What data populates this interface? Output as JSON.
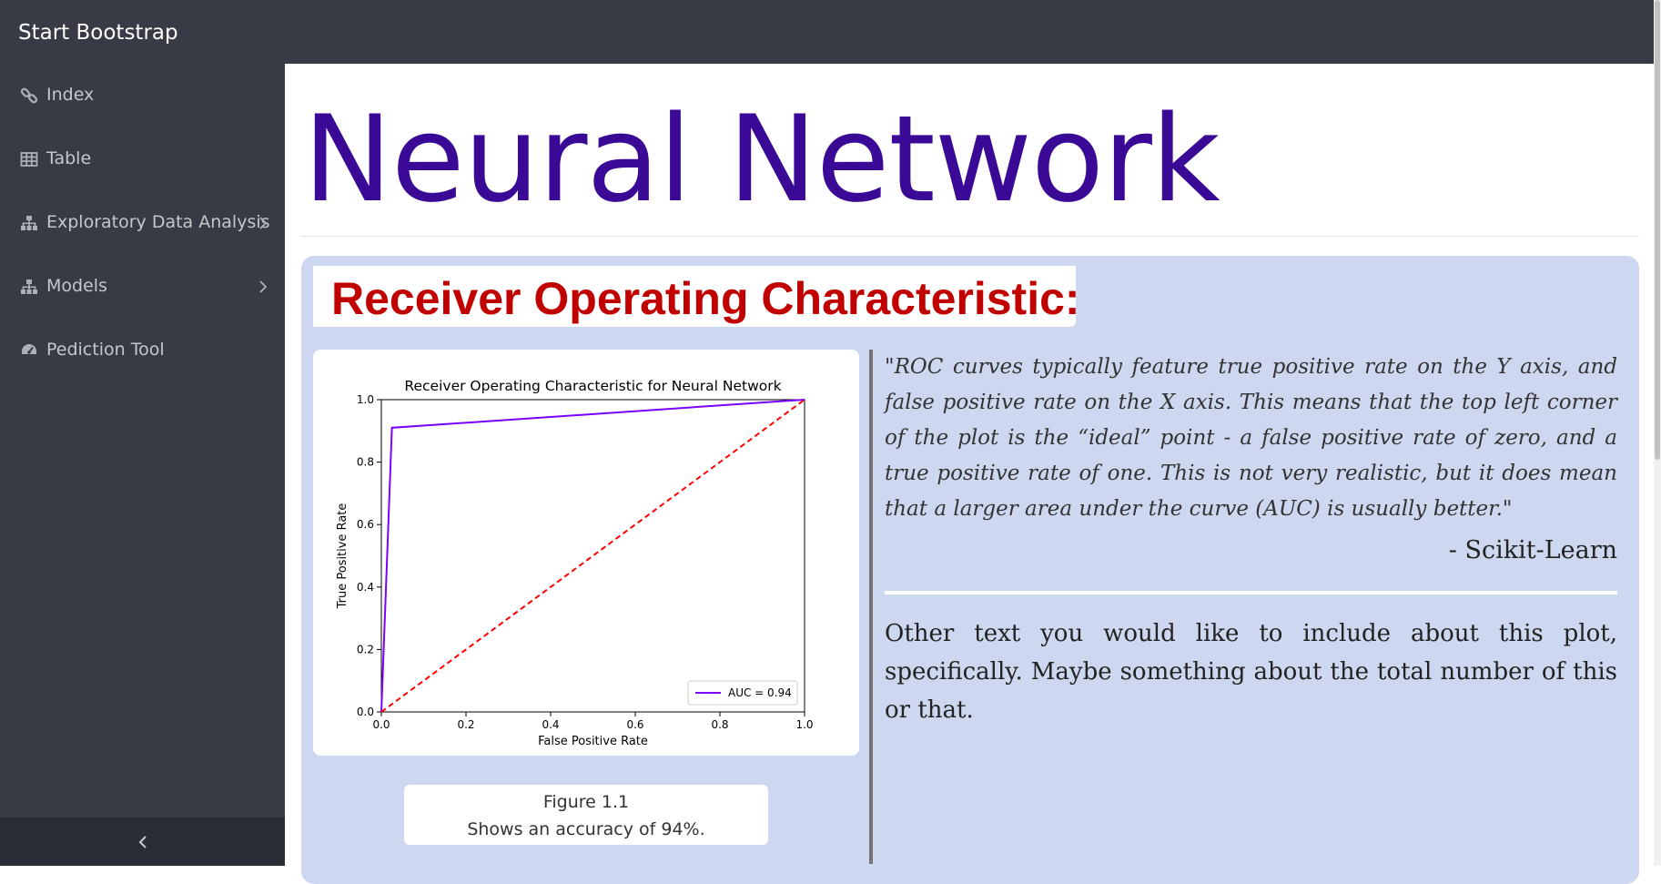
{
  "app": {
    "brand": "Start Bootstrap"
  },
  "sidebar": {
    "items": [
      {
        "label": "Index",
        "icon": "link-icon",
        "has_submenu": false
      },
      {
        "label": "Table",
        "icon": "table-icon",
        "has_submenu": false
      },
      {
        "label": "Exploratory Data Analysis",
        "icon": "sitemap-icon",
        "has_submenu": true
      },
      {
        "label": "Models",
        "icon": "sitemap-icon",
        "has_submenu": true
      },
      {
        "label": "Pediction Tool",
        "icon": "dashboard-icon",
        "has_submenu": false
      }
    ],
    "toggle_icon": "chevron-left-icon"
  },
  "page": {
    "title": "Neural Network",
    "section_title": "Receiver Operating Characteristic:",
    "figure": {
      "caption_label": "Figure 1.1",
      "caption_text": "Shows an accuracy of 94%."
    },
    "quote": "\"ROC curves typically feature true positive rate on the Y axis, and false positive rate on the X axis. This means that the top left corner of the plot is the “ideal” point - a false positive rate of zero, and a true positive rate of one. This is not very realistic, but it does mean that a larger area under the curve (AUC) is usually better.\"",
    "attribution": "- Scikit-Learn",
    "body_text": "Other text you would like to include about this plot, specifically. Maybe something about the total number of this or that."
  },
  "colors": {
    "title": "#3a0a96",
    "section_title": "#c10000",
    "card_bg": "#cdd8f0",
    "sidebar_bg": "#383a45",
    "roc_line": "#7a00ff",
    "baseline": "#ff0000"
  },
  "chart_data": {
    "type": "line",
    "title": "Receiver Operating Characteristic for Neural Network",
    "xlabel": "False Positive Rate",
    "ylabel": "True Positive Rate",
    "xlim": [
      0,
      1
    ],
    "ylim": [
      0,
      1
    ],
    "xticks": [
      "0.0",
      "0.2",
      "0.4",
      "0.6",
      "0.8",
      "1.0"
    ],
    "yticks": [
      "0.0",
      "0.2",
      "0.4",
      "0.6",
      "0.8",
      "1.0"
    ],
    "grid": false,
    "legend_position": "bottom-right",
    "series": [
      {
        "name": "AUC = 0.94",
        "style": "solid",
        "color": "#7a00ff",
        "x": [
          0.0,
          0.025,
          1.0
        ],
        "y": [
          0.0,
          0.91,
          1.0
        ]
      },
      {
        "style": "dashed",
        "color": "#ff0000",
        "x": [
          0.0,
          1.0
        ],
        "y": [
          0.0,
          1.0
        ]
      }
    ]
  }
}
